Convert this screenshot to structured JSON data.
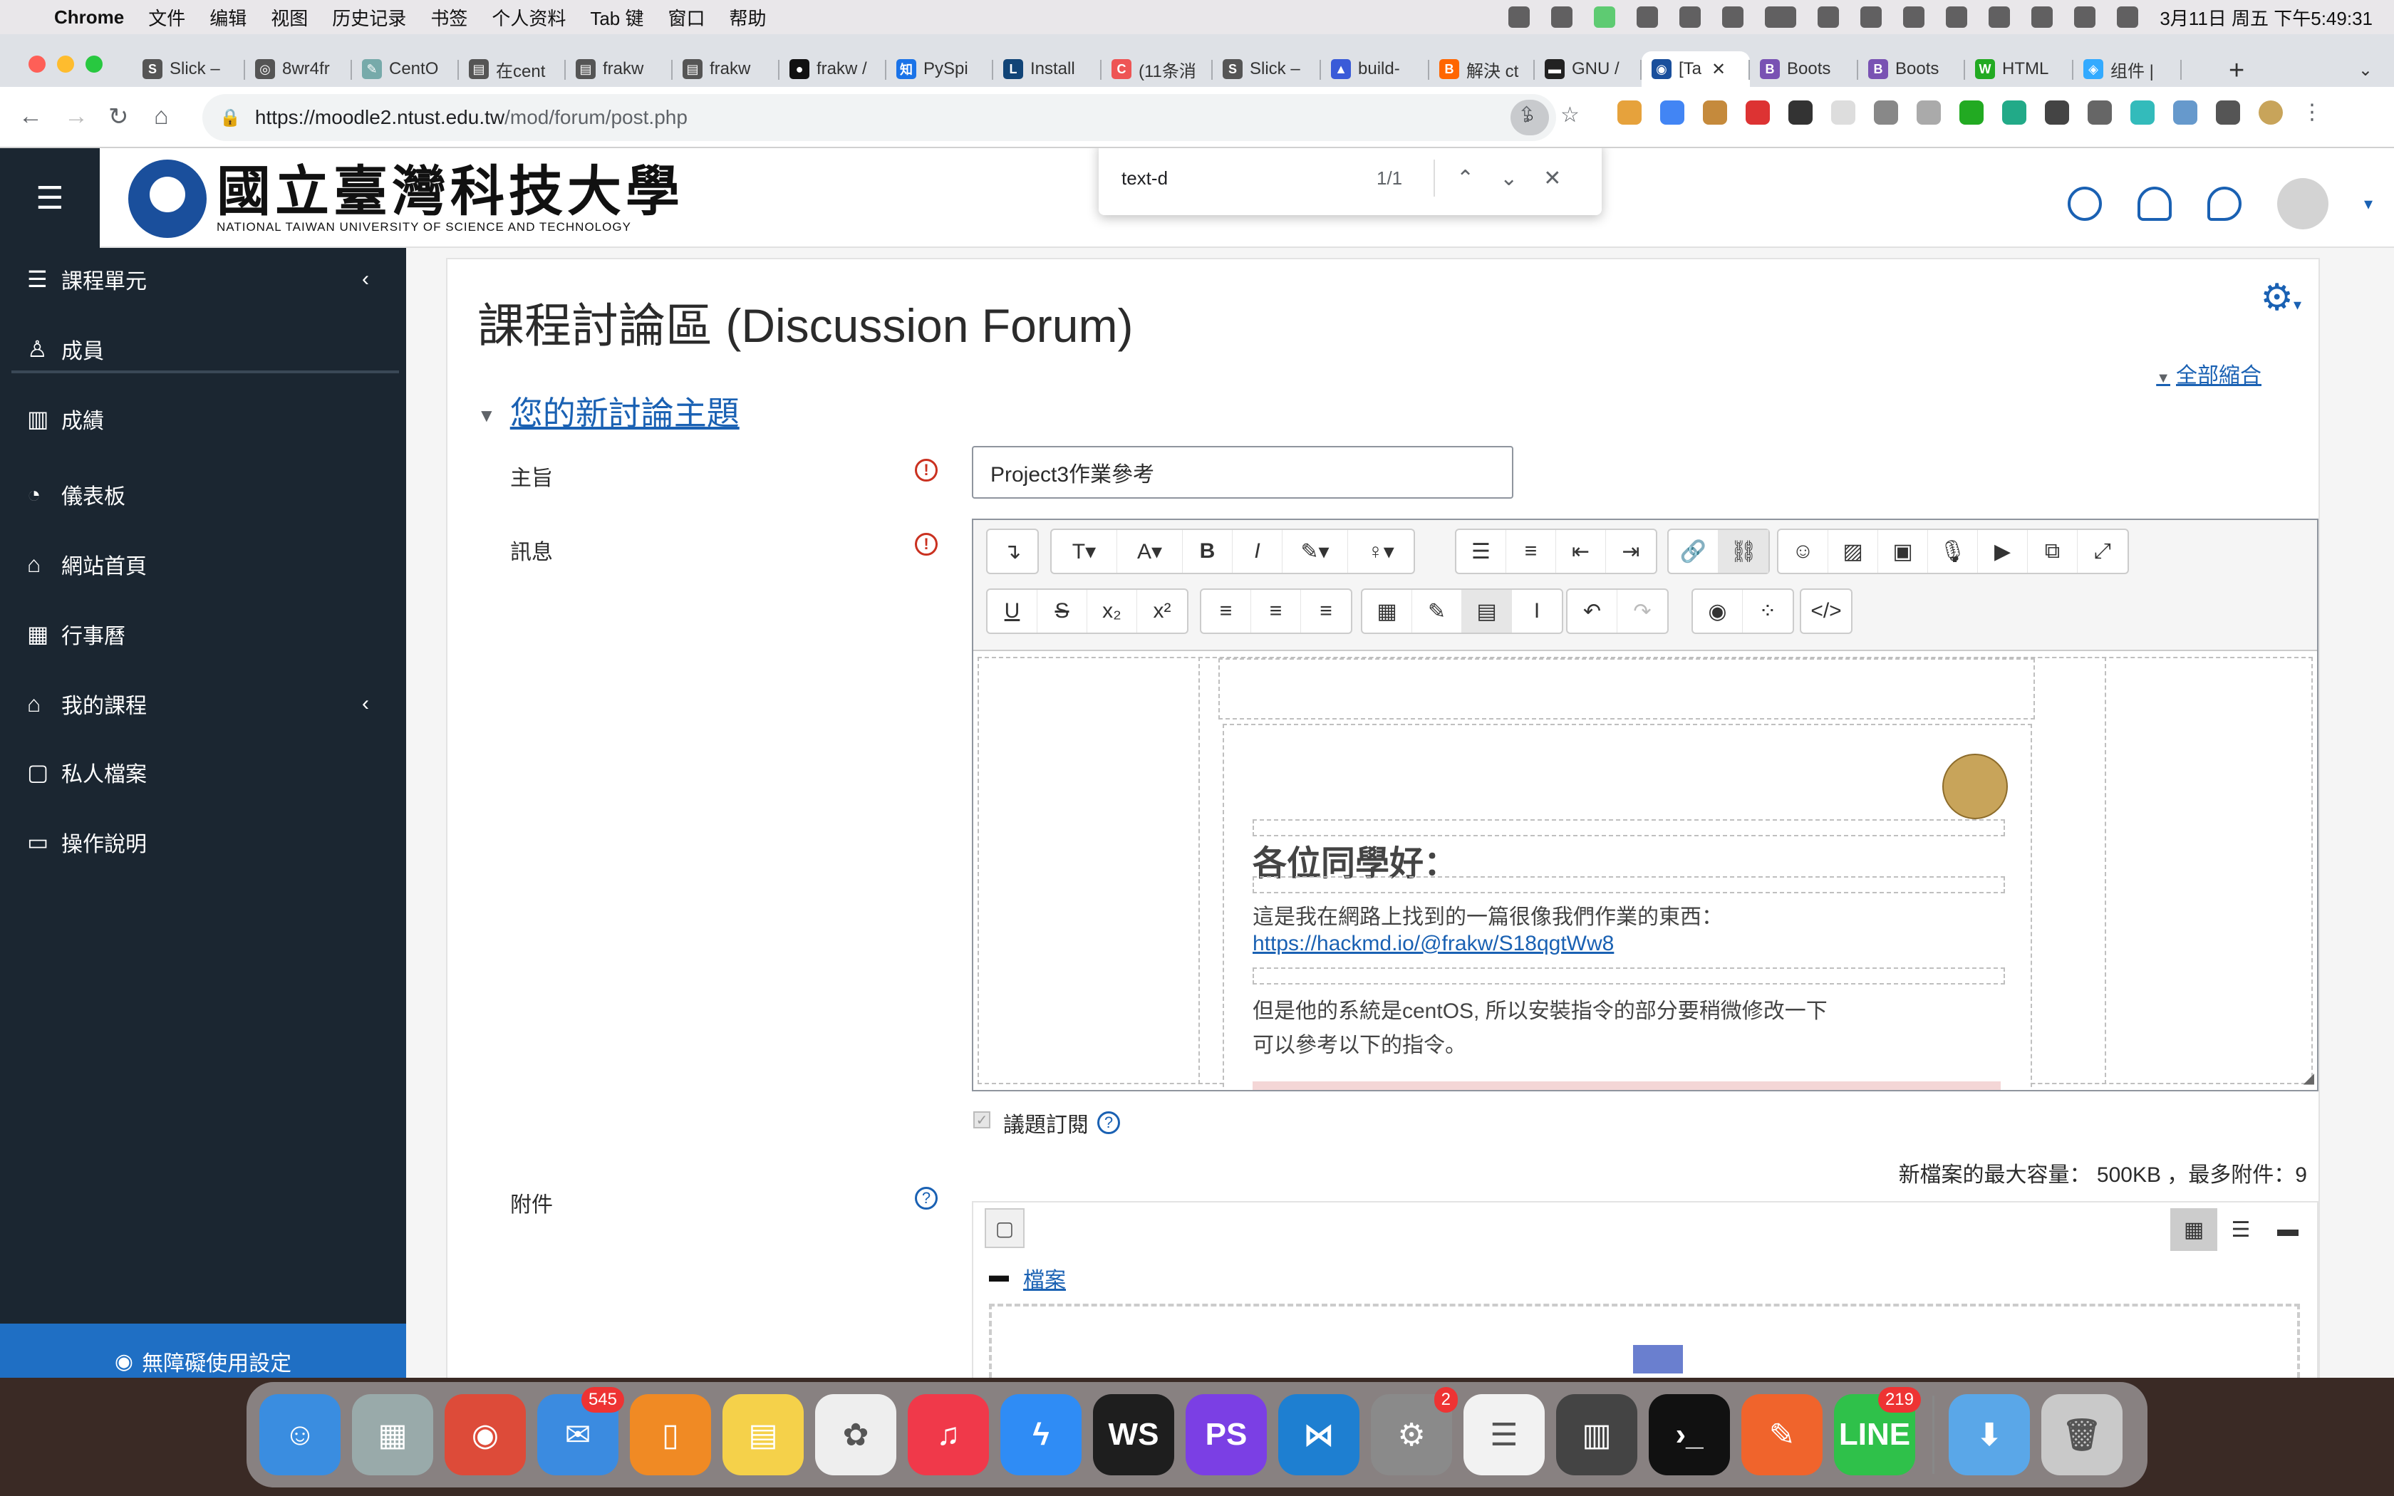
{
  "menubar": {
    "app": "Chrome",
    "items": [
      "文件",
      "编辑",
      "视图",
      "历史记录",
      "书签",
      "个人资料",
      "Tab 键",
      "窗口",
      "帮助"
    ],
    "clock": "3月11日 周五 下午5:49:31"
  },
  "tabs": [
    {
      "label": "Slick –",
      "color": "#555",
      "glyph": "S"
    },
    {
      "label": "8wr4fr",
      "color": "#555",
      "glyph": "◎"
    },
    {
      "label": "CentO",
      "color": "#7aa",
      "glyph": "✎"
    },
    {
      "label": "在cent",
      "color": "#555",
      "glyph": "▤"
    },
    {
      "label": "frakw",
      "color": "#555",
      "glyph": "▤"
    },
    {
      "label": "frakw",
      "color": "#555",
      "glyph": "▤"
    },
    {
      "label": "frakw /",
      "color": "#111",
      "glyph": "●"
    },
    {
      "label": "PySpi",
      "color": "#1a73e8",
      "glyph": "知"
    },
    {
      "label": "Install",
      "color": "#147",
      "glyph": "L"
    },
    {
      "label": "(11条消",
      "color": "#e55",
      "glyph": "C"
    },
    {
      "label": "Slick –",
      "color": "#555",
      "glyph": "S"
    },
    {
      "label": "build-",
      "color": "#3a5bd8",
      "glyph": "▲"
    },
    {
      "label": "解決 ct",
      "color": "#f60",
      "glyph": "B"
    },
    {
      "label": "GNU /",
      "color": "#222",
      "glyph": "▬"
    },
    {
      "label": "[Ta",
      "color": "#1a4f9c",
      "glyph": "◉",
      "active": true
    },
    {
      "label": "Boots",
      "color": "#7952b3",
      "glyph": "B"
    },
    {
      "label": "Boots",
      "color": "#7952b3",
      "glyph": "B"
    },
    {
      "label": "HTML",
      "color": "#2a2",
      "glyph": "W"
    },
    {
      "label": "组件 |",
      "color": "#3af",
      "glyph": "◈"
    }
  ],
  "address": {
    "host": "https://moodle2.ntust.edu.tw",
    "path": "/mod/forum/post.php"
  },
  "find": {
    "query": "text-d",
    "count": "1/1"
  },
  "site": {
    "logo_cn": "國立臺灣科技大學",
    "logo_en": "NATIONAL TAIWAN UNIVERSITY OF SCIENCE AND TECHNOLOGY"
  },
  "sidebar": {
    "items": [
      {
        "label": "課程單元",
        "icon": "list-icon",
        "glyph": "☰",
        "chev": true
      },
      {
        "label": "成員",
        "icon": "user-icon",
        "glyph": "♙"
      },
      {
        "label": "成績",
        "icon": "book-icon",
        "glyph": "▥"
      },
      {
        "label": "儀表板",
        "icon": "dashboard-icon",
        "glyph": "◔"
      },
      {
        "label": "網站首頁",
        "icon": "home-icon",
        "glyph": "⌂"
      },
      {
        "label": "行事曆",
        "icon": "calendar-icon",
        "glyph": "▦"
      },
      {
        "label": "我的課程",
        "icon": "graduation-cap-icon",
        "glyph": "⌂",
        "chev": true
      },
      {
        "label": "私人檔案",
        "icon": "file-icon",
        "glyph": "▢"
      },
      {
        "label": "操作說明",
        "icon": "folder-icon",
        "glyph": "▭"
      }
    ],
    "accessibility": "無障礙使用設定"
  },
  "main": {
    "title": "課程討論區 (Discussion Forum)",
    "collapse_all": "全部縮合",
    "section": "您的新討論主題",
    "subject_label": "主旨",
    "subject_value": "Project3作業參考",
    "message_label": "訊息",
    "message": {
      "greeting": "各位同學好：",
      "line1": "這是我在網路上找到的一篇很像我們作業的東西：",
      "link": "https://hackmd.io/@frakw/S18qgtWw8",
      "line2": "但是他的系統是centOS, 所以安裝指令的部分要稍微修改一下",
      "line3": "可以參考以下的指令。"
    },
    "subscribe_label": "議題訂閱",
    "attachments_label": "附件",
    "file_limits": "新檔案的最大容量： 500KB ，最多附件：9",
    "folder_label": "檔案"
  },
  "dock": [
    {
      "name": "finder",
      "color": "#3a8de0",
      "glyph": "☺"
    },
    {
      "name": "launchpad",
      "color": "#9aa",
      "glyph": "▦"
    },
    {
      "name": "chrome",
      "color": "#dd4b39",
      "glyph": "◉"
    },
    {
      "name": "mail",
      "color": "#3b8be0",
      "glyph": "✉",
      "badge": "545"
    },
    {
      "name": "books",
      "color": "#f08a24",
      "glyph": "▯"
    },
    {
      "name": "notes",
      "color": "#f5d14a",
      "glyph": "▤"
    },
    {
      "name": "photos",
      "color": "#eee",
      "glyph": "✿"
    },
    {
      "name": "music",
      "color": "#f0394a",
      "glyph": "♫"
    },
    {
      "name": "messenger",
      "color": "#2f8cf5",
      "glyph": "ϟ"
    },
    {
      "name": "webstorm",
      "color": "#1e1e1e",
      "glyph": "WS"
    },
    {
      "name": "phpstorm",
      "color": "#7b3fe4",
      "glyph": "PS"
    },
    {
      "name": "vscode",
      "color": "#1e7fd1",
      "glyph": "⋈"
    },
    {
      "name": "system-preferences",
      "color": "#8a8a8a",
      "glyph": "⚙",
      "badge": "2"
    },
    {
      "name": "reminders",
      "color": "#f2f2f2",
      "glyph": "☰"
    },
    {
      "name": "parallels",
      "color": "#444",
      "glyph": "▥"
    },
    {
      "name": "terminal",
      "color": "#111",
      "glyph": "›_"
    },
    {
      "name": "paw",
      "color": "#f0642c",
      "glyph": "✎"
    },
    {
      "name": "line",
      "color": "#2fc14a",
      "glyph": "LINE",
      "badge": "219"
    },
    {
      "name": "downloads",
      "color": "#5aa7e8",
      "glyph": "⬇"
    },
    {
      "name": "trash",
      "color": "#c9c9c9",
      "glyph": "🗑"
    }
  ]
}
